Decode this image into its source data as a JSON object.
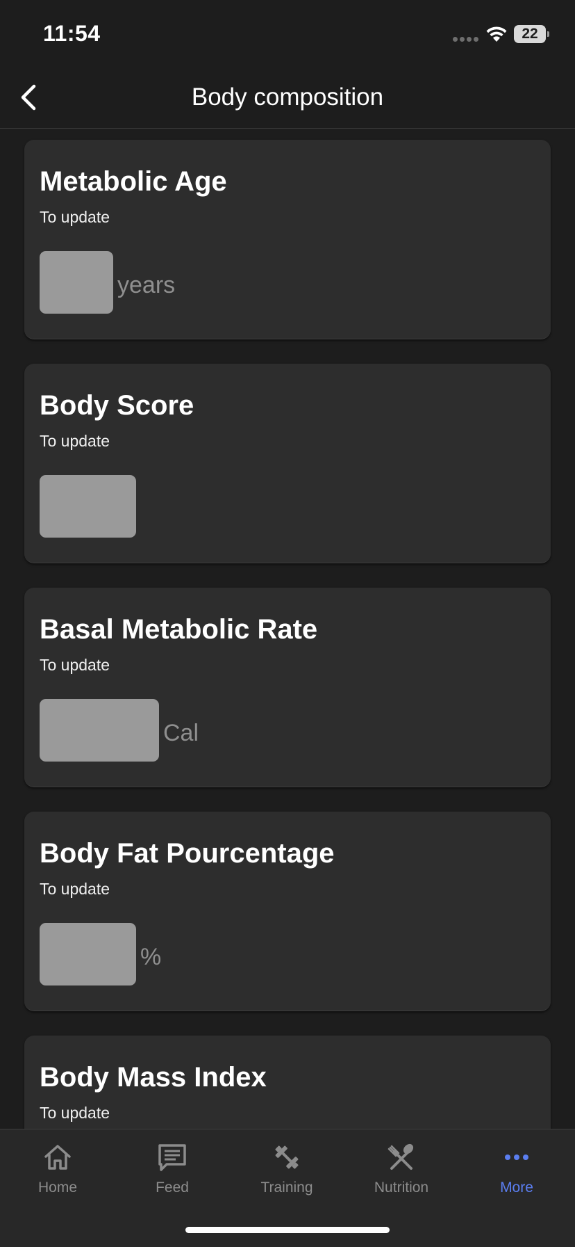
{
  "status_bar": {
    "time": "11:54",
    "battery_level": "22"
  },
  "header": {
    "title": "Body composition",
    "back_icon": "chevron-left-icon"
  },
  "cards": [
    {
      "title": "Metabolic Age",
      "subtitle": "To update",
      "unit": "years"
    },
    {
      "title": "Body Score",
      "subtitle": "To update",
      "unit": ""
    },
    {
      "title": "Basal Metabolic Rate",
      "subtitle": "To update",
      "unit": "Cal"
    },
    {
      "title": "Body Fat Pourcentage",
      "subtitle": "To update",
      "unit": "%"
    },
    {
      "title": "Body Mass Index",
      "subtitle": "To update",
      "unit": ""
    }
  ],
  "tab_bar": {
    "items": [
      {
        "label": "Home",
        "icon": "home-icon"
      },
      {
        "label": "Feed",
        "icon": "chat-icon"
      },
      {
        "label": "Training",
        "icon": "dumbbell-icon"
      },
      {
        "label": "Nutrition",
        "icon": "utensils-icon"
      },
      {
        "label": "More",
        "icon": "more-dots-icon"
      }
    ],
    "active_index": 4
  },
  "colors": {
    "background": "#1d1d1d",
    "card": "#2d2d2d",
    "placeholder": "#9a9a9a",
    "accent": "#5b7ef0",
    "inactive": "#8c8c8c"
  }
}
